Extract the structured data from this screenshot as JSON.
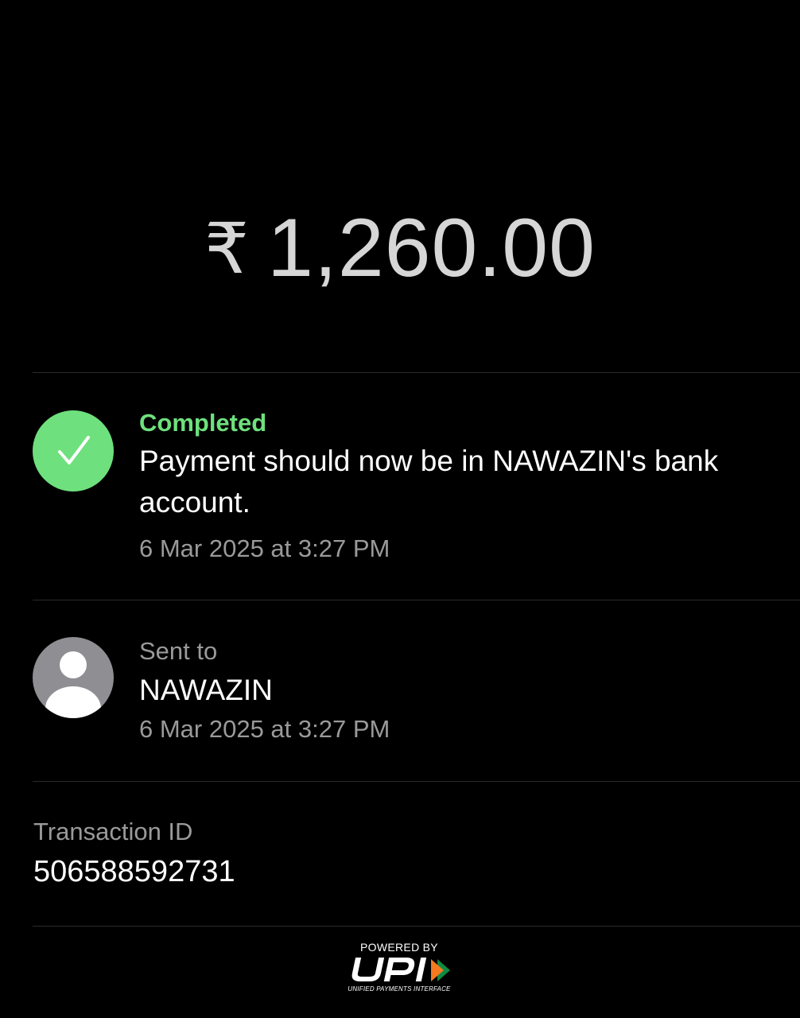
{
  "amount": {
    "currency_symbol": "₹",
    "value": "1,260.00"
  },
  "status": {
    "icon": "checkmark-icon",
    "label": "Completed",
    "message": "Payment should now be in NAWAZIN's bank account.",
    "timestamp": "6 Mar 2025 at 3:27 PM",
    "color": "#6ee07d"
  },
  "recipient": {
    "icon": "person-avatar-icon",
    "label": "Sent to",
    "name": "NAWAZIN",
    "timestamp": "6 Mar 2025 at 3:27 PM"
  },
  "transaction": {
    "label": "Transaction ID",
    "id": "506588592731"
  },
  "footer": {
    "powered_by": "POWERED BY",
    "brand": "UPI",
    "tagline": "UNIFIED PAYMENTS INTERFACE",
    "brand_colors": [
      "#f47920",
      "#0f8a45"
    ]
  }
}
